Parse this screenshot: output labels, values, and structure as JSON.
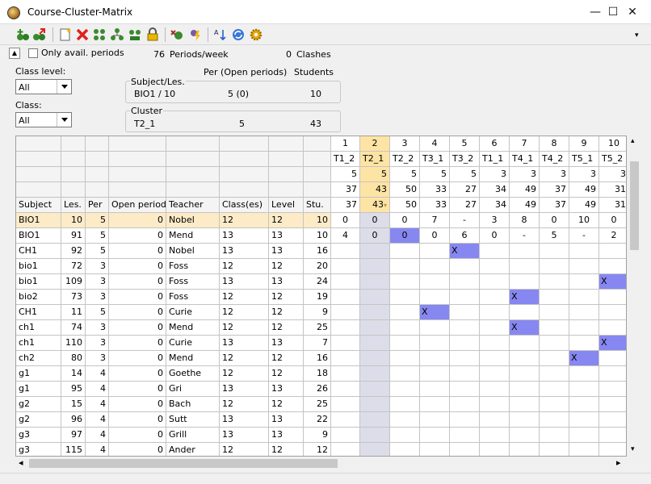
{
  "window": {
    "title": "Course-Cluster-Matrix",
    "minimize": "—",
    "maximize": "☐",
    "close": "✕"
  },
  "toolbar": {
    "icons": [
      "add-course-icon",
      "transfer-course-icon",
      "new-document-icon",
      "delete-icon",
      "cluster-icon",
      "cluster-tree-icon",
      "cluster-settings-icon",
      "lock-icon",
      "optimize-icon",
      "auto-schedule-icon",
      "sort-icon",
      "refresh-icon",
      "settings-icon"
    ]
  },
  "filter": {
    "collapse_symbol": "▲",
    "only_avail_label": "Only avail. periods",
    "periods_week_value": "76",
    "periods_week_label": "Periods/week",
    "clashes_value": "0",
    "clashes_label": "Clashes",
    "class_level_label": "Class level:",
    "class_level_value": "All",
    "class_label": "Class:",
    "class_value": "All"
  },
  "summary": {
    "col_per": "Per (Open periods)",
    "col_students": "Students",
    "subject_group_label": "Subject/Les.",
    "subject_name": "BIO1 / 10",
    "subject_per": "5 (0)",
    "subject_students": "10",
    "cluster_group_label": "Cluster",
    "cluster_name": "T2_1",
    "cluster_per": "5",
    "cluster_students": "43"
  },
  "colors": {
    "selected_row": "#fdebc8",
    "selected_col": "#dcdde8",
    "highlight": "#8787f2",
    "header_selected": "#fde4a4"
  },
  "grid": {
    "headers": [
      "Subject",
      "Les.",
      "Per",
      "Open periods",
      "Teacher",
      "Class(es)",
      "Level",
      "Stu."
    ],
    "cluster_numbers": [
      "1",
      "2",
      "3",
      "4",
      "5",
      "6",
      "7",
      "8",
      "9",
      "10"
    ],
    "cluster_names": [
      "T1_2",
      "T2_1",
      "T2_2",
      "T3_1",
      "T3_2",
      "T1_1",
      "T4_1",
      "T4_2",
      "T5_1",
      "T5_2"
    ],
    "cluster_periods": [
      "5",
      "5",
      "5",
      "5",
      "5",
      "3",
      "3",
      "3",
      "3",
      "3"
    ],
    "cluster_students_a": [
      "37",
      "43",
      "50",
      "33",
      "27",
      "34",
      "49",
      "37",
      "49",
      "31"
    ],
    "cluster_students_b": [
      "37",
      "43",
      "50",
      "33",
      "27",
      "34",
      "49",
      "37",
      "49",
      "31"
    ],
    "sort_marker": "▾",
    "rows": [
      {
        "subject": "BIO1",
        "les": "10",
        "per": "5",
        "open": "0",
        "teacher": "Nobel",
        "classes": "12",
        "level": "12",
        "stu": "10",
        "cells": [
          "0",
          "0",
          "0",
          "7",
          "-",
          "3",
          "8",
          "0",
          "10",
          "0"
        ]
      },
      {
        "subject": "BIO1",
        "les": "91",
        "per": "5",
        "open": "0",
        "teacher": "Mend",
        "classes": "13",
        "level": "13",
        "stu": "10",
        "cells": [
          "4",
          "0",
          "0",
          "0",
          "6",
          "0",
          "-",
          "5",
          "-",
          "2"
        ]
      },
      {
        "subject": "CH1",
        "les": "92",
        "per": "5",
        "open": "0",
        "teacher": "Nobel",
        "classes": "13",
        "level": "13",
        "stu": "16",
        "cells": [
          "",
          "",
          "",
          "",
          "X",
          "",
          "",
          "",
          "",
          ""
        ]
      },
      {
        "subject": "bio1",
        "les": "72",
        "per": "3",
        "open": "0",
        "teacher": "Foss",
        "classes": "12",
        "level": "12",
        "stu": "20",
        "cells": [
          "",
          "",
          "",
          "",
          "",
          "",
          "",
          "",
          "",
          ""
        ]
      },
      {
        "subject": "bio1",
        "les": "109",
        "per": "3",
        "open": "0",
        "teacher": "Foss",
        "classes": "13",
        "level": "13",
        "stu": "24",
        "cells": [
          "",
          "",
          "",
          "",
          "",
          "",
          "",
          "",
          "",
          "X"
        ]
      },
      {
        "subject": "bio2",
        "les": "73",
        "per": "3",
        "open": "0",
        "teacher": "Foss",
        "classes": "12",
        "level": "12",
        "stu": "19",
        "cells": [
          "",
          "",
          "",
          "",
          "",
          "",
          "X",
          "",
          "",
          ""
        ]
      },
      {
        "subject": "CH1",
        "les": "11",
        "per": "5",
        "open": "0",
        "teacher": "Curie",
        "classes": "12",
        "level": "12",
        "stu": "9",
        "cells": [
          "",
          "",
          "",
          "X",
          "",
          "",
          "",
          "",
          "",
          ""
        ]
      },
      {
        "subject": "ch1",
        "les": "74",
        "per": "3",
        "open": "0",
        "teacher": "Mend",
        "classes": "12",
        "level": "12",
        "stu": "25",
        "cells": [
          "",
          "",
          "",
          "",
          "",
          "",
          "X",
          "",
          "",
          ""
        ]
      },
      {
        "subject": "ch1",
        "les": "110",
        "per": "3",
        "open": "0",
        "teacher": "Curie",
        "classes": "13",
        "level": "13",
        "stu": "7",
        "cells": [
          "",
          "",
          "",
          "",
          "",
          "",
          "",
          "",
          "",
          "X"
        ]
      },
      {
        "subject": "ch2",
        "les": "80",
        "per": "3",
        "open": "0",
        "teacher": "Mend",
        "classes": "12",
        "level": "12",
        "stu": "16",
        "cells": [
          "",
          "",
          "",
          "",
          "",
          "",
          "",
          "",
          "X",
          ""
        ]
      },
      {
        "subject": "g1",
        "les": "14",
        "per": "4",
        "open": "0",
        "teacher": "Goethe",
        "classes": "12",
        "level": "12",
        "stu": "18",
        "cells": [
          "",
          "",
          "",
          "",
          "",
          "",
          "",
          "",
          "",
          ""
        ]
      },
      {
        "subject": "g1",
        "les": "95",
        "per": "4",
        "open": "0",
        "teacher": "Gri",
        "classes": "13",
        "level": "13",
        "stu": "26",
        "cells": [
          "",
          "",
          "",
          "",
          "",
          "",
          "",
          "",
          "",
          ""
        ]
      },
      {
        "subject": "g2",
        "les": "15",
        "per": "4",
        "open": "0",
        "teacher": "Bach",
        "classes": "12",
        "level": "12",
        "stu": "25",
        "cells": [
          "",
          "",
          "",
          "",
          "",
          "",
          "",
          "",
          "",
          ""
        ]
      },
      {
        "subject": "g2",
        "les": "96",
        "per": "4",
        "open": "0",
        "teacher": "Sutt",
        "classes": "13",
        "level": "13",
        "stu": "22",
        "cells": [
          "",
          "",
          "",
          "",
          "",
          "",
          "",
          "",
          "",
          ""
        ]
      },
      {
        "subject": "g3",
        "les": "97",
        "per": "4",
        "open": "0",
        "teacher": "Grill",
        "classes": "13",
        "level": "13",
        "stu": "9",
        "cells": [
          "",
          "",
          "",
          "",
          "",
          "",
          "",
          "",
          "",
          ""
        ]
      },
      {
        "subject": "g3",
        "les": "115",
        "per": "4",
        "open": "0",
        "teacher": "Ander",
        "classes": "12",
        "level": "12",
        "stu": "12",
        "cells": [
          "",
          "",
          "",
          "",
          "",
          "",
          "",
          "",
          "",
          ""
        ]
      }
    ],
    "highlights": [
      [
        1,
        2
      ],
      [
        2,
        4
      ],
      [
        4,
        9
      ],
      [
        5,
        6
      ],
      [
        6,
        3
      ],
      [
        7,
        6
      ],
      [
        8,
        9
      ],
      [
        9,
        8
      ]
    ]
  },
  "scroll": {
    "left": "◂",
    "right": "▸",
    "up": "▴",
    "down": "▾",
    "more": "▾"
  }
}
